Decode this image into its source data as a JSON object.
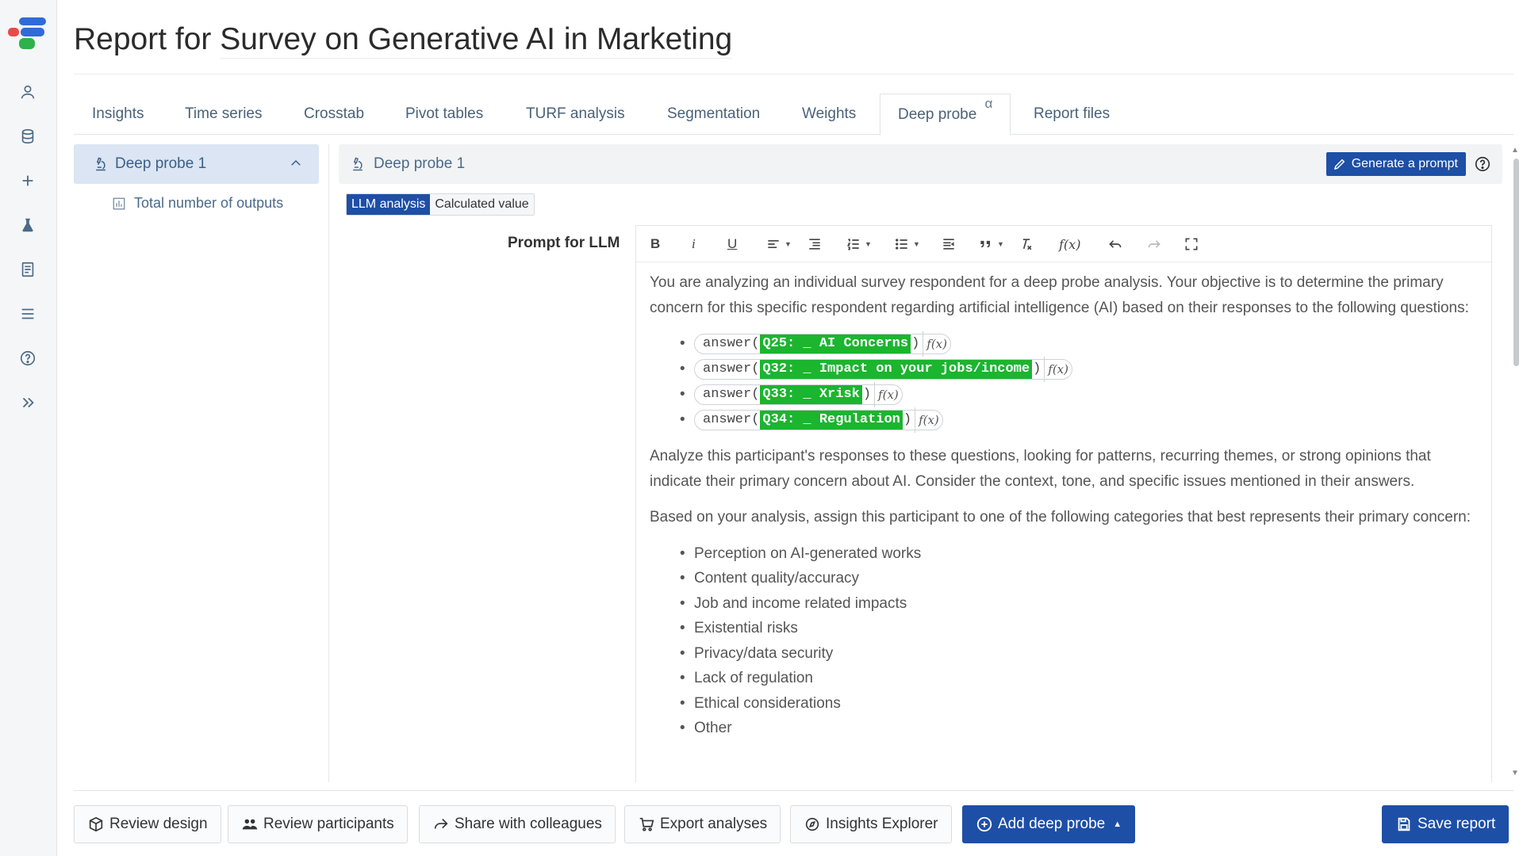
{
  "header": {
    "title_prefix": "Report for",
    "title_subject": "Survey on Generative AI in Marketing"
  },
  "tabs": [
    {
      "label": "Insights"
    },
    {
      "label": "Time series"
    },
    {
      "label": "Crosstab"
    },
    {
      "label": "Pivot tables"
    },
    {
      "label": "TURF analysis"
    },
    {
      "label": "Segmentation"
    },
    {
      "label": "Weights"
    },
    {
      "label": "Deep probe",
      "badge": "α",
      "active": true
    },
    {
      "label": "Report files"
    }
  ],
  "tree": {
    "item": "Deep probe 1",
    "child": "Total number of outputs"
  },
  "panel": {
    "title": "Deep probe 1",
    "generate_label": "Generate a prompt",
    "mode_llm": "LLM analysis",
    "mode_calc": "Calculated value",
    "prompt_label": "Prompt for LLM"
  },
  "editor": {
    "intro": "You are analyzing an individual survey respondent for a deep probe analysis. Your objective is to determine the primary concern for this specific respondent regarding artificial intelligence (AI) based on their responses to the following questions:",
    "fn_name": "answer(",
    "fn_close": ")",
    "fx_label": "f(x)",
    "questions": [
      "Q25: _ AI Concerns",
      "Q32: _ Impact on your jobs/income",
      "Q33: _ Xrisk",
      "Q34: _ Regulation"
    ],
    "analyze": "Analyze this participant's responses to these questions, looking for patterns, recurring themes, or strong opinions that indicate their primary concern about AI. Consider the context, tone, and specific issues mentioned in their answers.",
    "assign": "Based on your analysis, assign this participant to one of the following categories that best represents their primary concern:",
    "categories": [
      "Perception on AI-generated works",
      "Content quality/accuracy",
      "Job and income related impacts",
      "Existential risks",
      "Privacy/data security",
      "Lack of regulation",
      "Ethical considerations",
      "Other"
    ]
  },
  "toolbar": {
    "bold": "B",
    "italic": "i",
    "underline": "U",
    "fx": "f(x)"
  },
  "footer": {
    "review_design": "Review design",
    "review_participants": "Review participants",
    "share": "Share with colleagues",
    "export": "Export analyses",
    "insights_explorer": "Insights Explorer",
    "add_probe": "Add deep probe",
    "save": "Save report"
  },
  "colors": {
    "primary": "#1e4fa6",
    "highlight": "#1bb52e",
    "tree_active": "#dbe5f3"
  }
}
